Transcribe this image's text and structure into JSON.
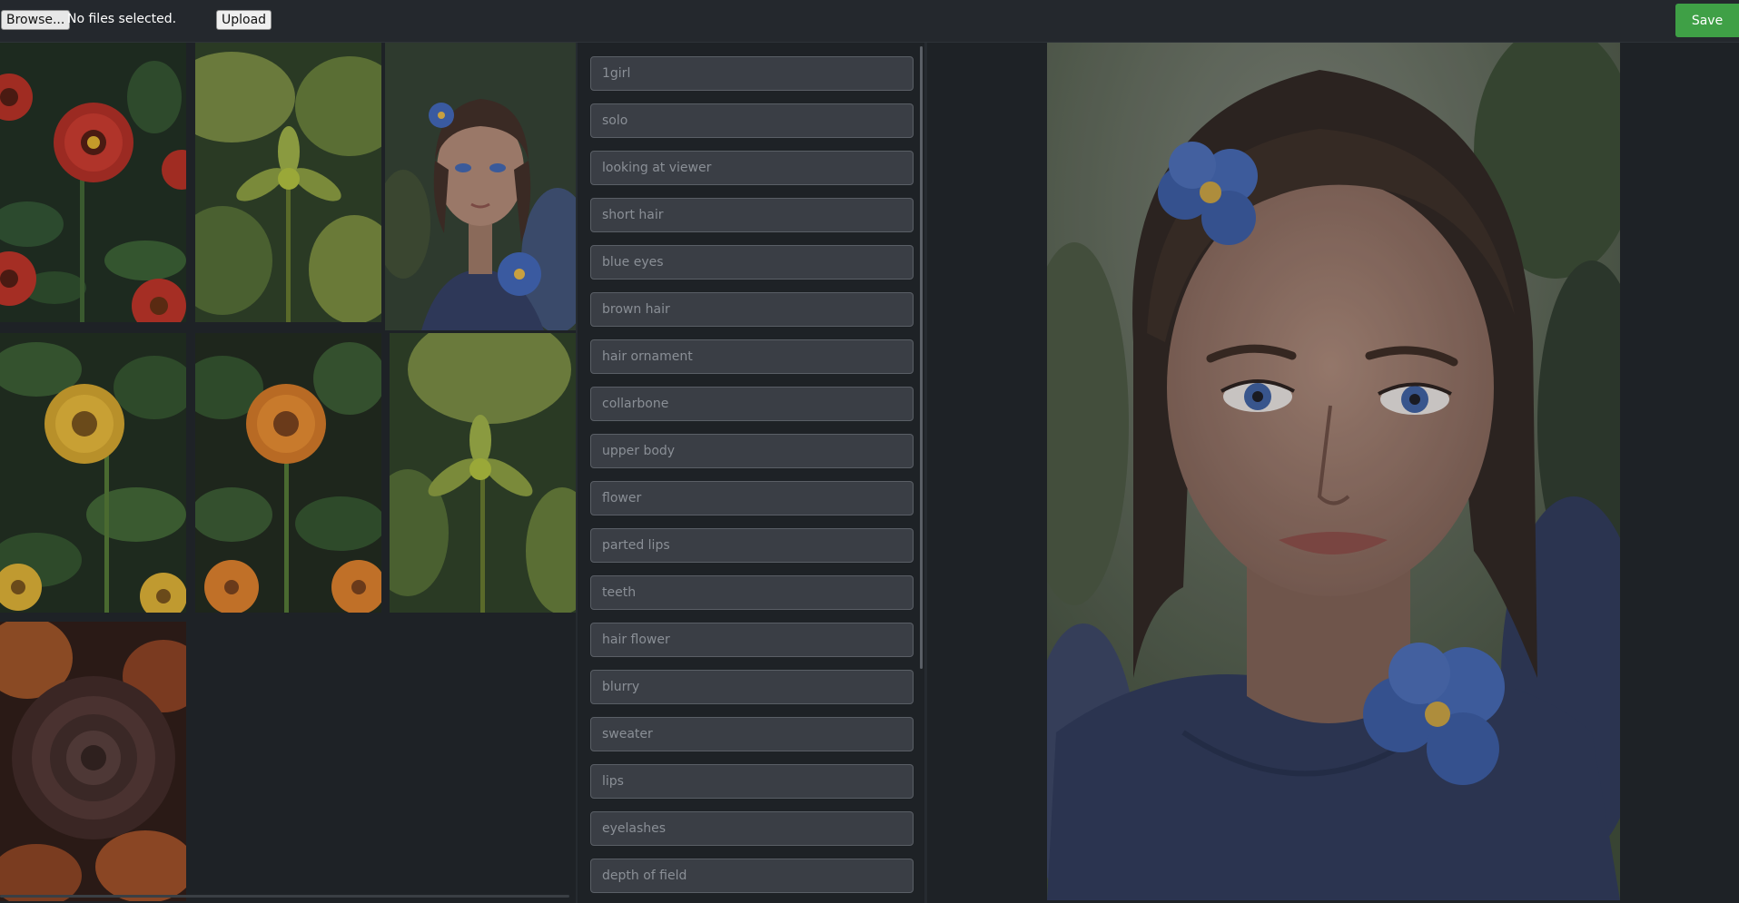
{
  "toolbar": {
    "browse_label": "Browse...",
    "file_status": "No files selected.",
    "upload_label": "Upload",
    "save_label": "Save"
  },
  "colors": {
    "background": "#1e2226",
    "topbar": "#24282d",
    "save_button": "#3fa046",
    "tag_box": "#3a3e45",
    "tag_text": "#8a8f96"
  },
  "gallery": {
    "items": [
      {
        "subject": "red flowers"
      },
      {
        "subject": "green leaf plant"
      },
      {
        "subject": "girl with blue flower"
      },
      {
        "subject": "yellow flowers"
      },
      {
        "subject": "orange flowers"
      },
      {
        "subject": "green leaf plant"
      },
      {
        "subject": "dark red rose"
      }
    ]
  },
  "tags": [
    "1girl",
    "solo",
    "looking at viewer",
    "short hair",
    "blue eyes",
    "brown hair",
    "hair ornament",
    "collarbone",
    "upper body",
    "flower",
    "parted lips",
    "teeth",
    "hair flower",
    "blurry",
    "sweater",
    "lips",
    "eyelashes",
    "depth of field"
  ]
}
